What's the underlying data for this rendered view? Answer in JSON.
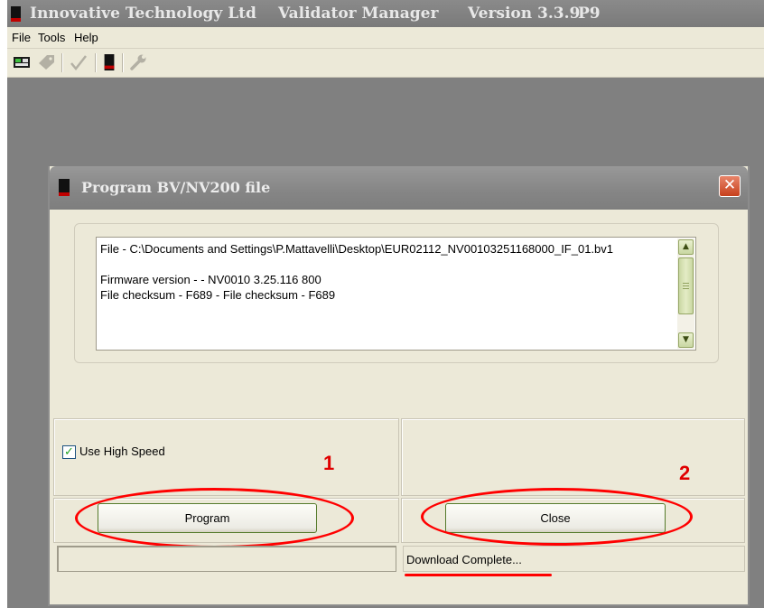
{
  "app": {
    "title_company": "Innovative Technology Ltd",
    "title_app": "Validator Manager",
    "title_version": "Version 3.3.9",
    "title_variant": "P9"
  },
  "menu": {
    "items": [
      "File",
      "Tools",
      "Help"
    ]
  },
  "toolbar": {
    "icons": [
      "connect-icon",
      "tag-icon",
      "check-icon",
      "validator-icon",
      "wrench-icon"
    ]
  },
  "dialog": {
    "title": "Program BV/NV200 file",
    "close_symbol": "✕",
    "info_lines": [
      "File - C:\\Documents and Settings\\P.Mattavelli\\Desktop\\EUR02112_NV00103251168000_IF_01.bv1",
      "",
      "Firmware version - - NV0010 3.25.116 800",
      "File checksum - F689 - File checksum - F689"
    ],
    "checkbox": {
      "label": "Use High Speed",
      "checked": true
    },
    "buttons": {
      "program": "Program",
      "close": "Close"
    },
    "status": {
      "left": "",
      "right": "Download Complete..."
    },
    "annotations": {
      "num1": "1",
      "num2": "2"
    }
  },
  "colors": {
    "title_bar": "#7f7f7f",
    "dialog_bg": "#ece9d8",
    "annotation_red": "#ff0000",
    "button_border": "#557b2b"
  }
}
